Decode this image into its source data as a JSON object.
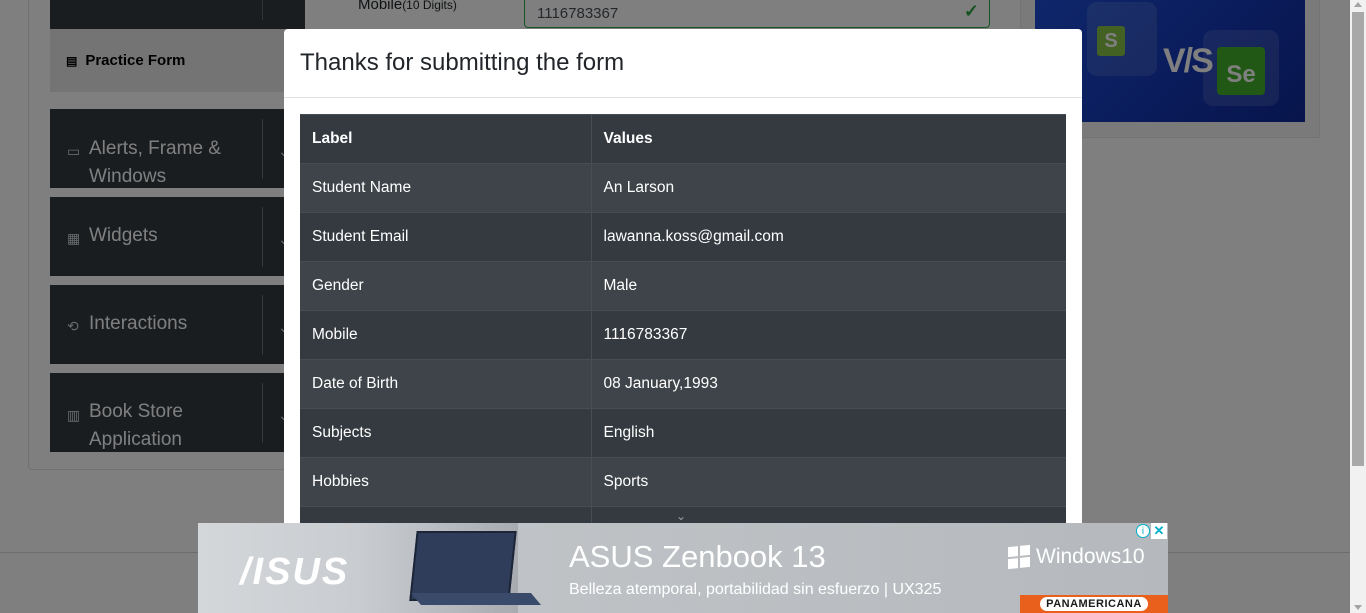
{
  "sidebar": {
    "practice_form": "Practice Form",
    "groups": [
      {
        "label": "Alerts, Frame & Windows",
        "icon": "window-icon"
      },
      {
        "label": "Widgets",
        "icon": "widgets-icon"
      },
      {
        "label": "Interactions",
        "icon": "interactions-icon"
      },
      {
        "label": "Book Store Application",
        "icon": "books-icon"
      }
    ]
  },
  "form": {
    "mobile_label": "Mobile",
    "mobile_hint": "(10 Digits)",
    "mobile_value": "1116783367"
  },
  "modal": {
    "title": "Thanks for submitting the form",
    "headers": {
      "label": "Label",
      "values": "Values"
    },
    "rows": [
      {
        "label": "Student Name",
        "value": "An Larson"
      },
      {
        "label": "Student Email",
        "value": "lawanna.koss@gmail.com"
      },
      {
        "label": "Gender",
        "value": "Male"
      },
      {
        "label": "Mobile",
        "value": "1116783367"
      },
      {
        "label": "Date of Birth",
        "value": "08 January,1993"
      },
      {
        "label": "Subjects",
        "value": "English"
      },
      {
        "label": "Hobbies",
        "value": "Sports"
      }
    ]
  },
  "ad": {
    "brand_logo": "/ISUS",
    "title": "ASUS Zenbook 13",
    "subtitle": "Belleza atemporal, portabilidad sin esfuerzo  | UX325",
    "windows": "Windows10",
    "retailer": "PANAMERICANA",
    "info_icon": "info-icon",
    "close_icon": "close-icon"
  },
  "colors": {
    "modal_table_dark": "#343a40",
    "modal_table_stripe": "#3e444a",
    "sidebar_dark": "#353b41",
    "success_green": "#28a745",
    "banner_blue": "#1e4fd6"
  }
}
